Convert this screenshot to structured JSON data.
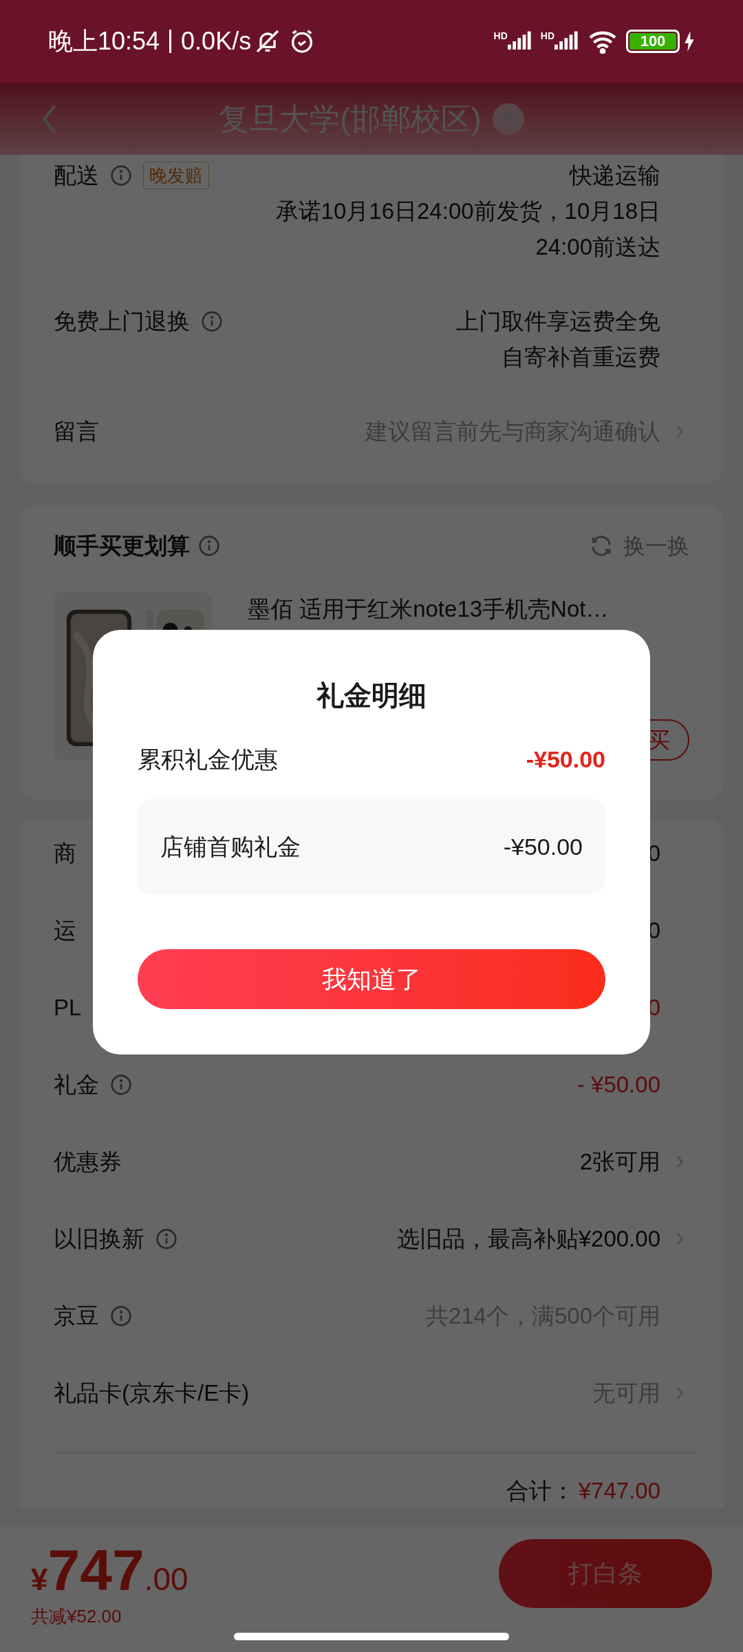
{
  "status_bar": {
    "time": "晚上10:54",
    "speed": "0.0K/s",
    "network_labels": [
      "HD",
      "HD"
    ],
    "battery": "100"
  },
  "header": {
    "title": "复旦大学(邯郸校区)"
  },
  "delivery_card": {
    "rows": [
      {
        "label": "配送",
        "info": true,
        "tag": "晚发赔",
        "lines": [
          "快递运输",
          "承诺10月16日24:00前发货，10月18日",
          "24:00前送达"
        ],
        "kind": "plain",
        "chevron": false
      },
      {
        "label": "免费上门退换",
        "info": true,
        "lines": [
          "上门取件享运费全免",
          "自寄补首重运费"
        ],
        "kind": "plain",
        "chevron": false
      },
      {
        "label": "留言",
        "info": false,
        "lines": [
          "建议留言前先与商家沟通确认"
        ],
        "kind": "hint",
        "chevron": true
      }
    ]
  },
  "recommend_card": {
    "title": "顺手买更划算",
    "refresh": "换一换",
    "product": {
      "kind": "picture",
      "title": "墨佰 适用于红米note13手机壳Not…",
      "button": "买"
    }
  },
  "price_card": {
    "rows": [
      {
        "label": "商",
        "info": false,
        "lines": [
          "0"
        ],
        "kind": "plain",
        "chevron": false
      },
      {
        "label": "运",
        "info": false,
        "lines": [
          "0"
        ],
        "kind": "plain",
        "chevron": false
      },
      {
        "label": "PL",
        "info": false,
        "lines": [
          "0"
        ],
        "kind": "discount",
        "chevron": false
      },
      {
        "label": "礼金",
        "info": true,
        "lines": [
          "- ¥50.00"
        ],
        "kind": "discount",
        "chevron": false
      },
      {
        "label": "优惠券",
        "info": false,
        "lines": [
          "2张可用"
        ],
        "kind": "plain",
        "chevron": true
      },
      {
        "label": "以旧换新",
        "info": true,
        "lines": [
          "选旧品，最高补贴¥200.00"
        ],
        "kind": "plain",
        "chevron": true
      },
      {
        "label": "京豆",
        "info": true,
        "lines": [
          "共214个，满500个可用"
        ],
        "kind": "hint",
        "chevron": false
      },
      {
        "label": "礼品卡(京东卡/E卡)",
        "info": false,
        "lines": [
          "无可用"
        ],
        "kind": "hint",
        "chevron": true
      }
    ],
    "total_label": "合计：",
    "total": "¥747.00"
  },
  "bottom_bar": {
    "currency": "¥",
    "price": "747",
    "decimals": ".00",
    "saved": "共减¥52.00",
    "button": "打白条"
  },
  "modal": {
    "title": "礼金明细",
    "summary": {
      "label": "累积礼金优惠",
      "amount": "-¥50.00"
    },
    "items": [
      {
        "label": "店铺首购礼金",
        "amount": "-¥50.00"
      }
    ],
    "button": "我知道了"
  }
}
